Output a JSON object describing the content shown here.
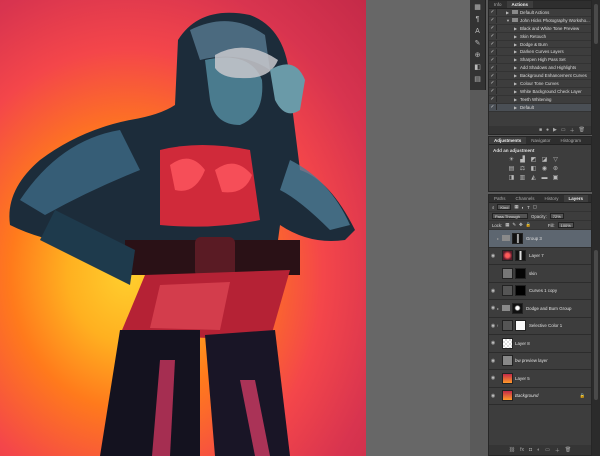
{
  "colors": {
    "panel_bg": "#3d3d3d",
    "selected_row": "#5d6670",
    "canvas_top": "#c42a48",
    "canvas_glow": "#ffcf2e"
  },
  "tools_strip": {
    "icons": [
      "layer-comps-icon",
      "paragraph-icon",
      "character-icon",
      "brush-icon",
      "clone-source-icon",
      "styles-icon",
      "swatches-icon"
    ]
  },
  "actions_panel": {
    "tabs": [
      "Info",
      "Actions"
    ],
    "active_tab": "Actions",
    "items": [
      {
        "label": "Default Actions",
        "set": true
      },
      {
        "label": "John Hicks Photography Worksho...",
        "set": true,
        "open": true
      },
      {
        "label": "Black and White Tone Preview"
      },
      {
        "label": "Skin Retouch"
      },
      {
        "label": "Dodge & Burn"
      },
      {
        "label": "Darken Curves Layers"
      },
      {
        "label": "Sharpen High Pass Set"
      },
      {
        "label": "Add Shadows and Highlights"
      },
      {
        "label": "Background Enhancement Curves"
      },
      {
        "label": "Colour Tone Curves"
      },
      {
        "label": "White Background Check Layer"
      },
      {
        "label": "Teeth Whitening"
      },
      {
        "label": "Default",
        "selected": true
      }
    ]
  },
  "adjustments_panel": {
    "tabs": [
      "Adjustments",
      "Navigator",
      "Histogram"
    ],
    "active_tab": "Adjustments",
    "title": "Add an adjustment"
  },
  "layers_panel": {
    "tabs": [
      "Paths",
      "Channels",
      "History",
      "Layers"
    ],
    "active_tab": "Layers",
    "filter_label": "Kind",
    "blend_mode": "Pass Through",
    "opacity_label": "Opacity:",
    "opacity_value": "72%",
    "lock_label": "Lock:",
    "fill_label": "Fill:",
    "fill_value": "100%",
    "layers": [
      {
        "name": "Group 3",
        "type": "group",
        "selected": true
      },
      {
        "name": "Layer 7",
        "type": "masked",
        "visible": true
      },
      {
        "name": "skin",
        "type": "masked"
      },
      {
        "name": "Curves 1 copy",
        "type": "adjust",
        "visible": true
      },
      {
        "name": "Dodge and Burn Group",
        "type": "group",
        "visible": true
      },
      {
        "name": "Selective Color 1",
        "type": "adjust",
        "visible": true
      },
      {
        "name": "Layer 8",
        "type": "pixel",
        "visible": true
      },
      {
        "name": "bw preview layer",
        "type": "pixel",
        "visible": true
      },
      {
        "name": "Layer 5",
        "type": "photo",
        "visible": true
      },
      {
        "name": "Background",
        "type": "photo",
        "visible": true,
        "italic": true,
        "locked": true
      }
    ]
  }
}
